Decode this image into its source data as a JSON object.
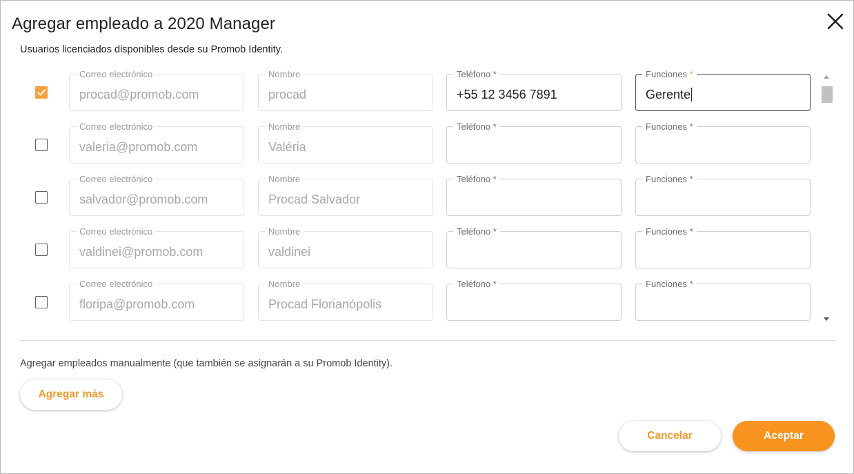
{
  "dialog": {
    "title": "Agregar empleado a 2020 Manager",
    "subtitle": "Usuarios licenciados disponibles desde su Promob Identity.",
    "manual_text": "Agregar empleados manualmente (que también se asignarán a su Promob Identity).",
    "add_more_label": "Agregar más",
    "cancel_label": "Cancelar",
    "accept_label": "Aceptar"
  },
  "labels": {
    "email": "Correo electrónico",
    "name": "Nombre",
    "phone": "Teléfono",
    "role": "Funciones",
    "required_mark": "*"
  },
  "users": [
    {
      "checked": true,
      "email": "procad@promob.com",
      "name": "procad",
      "phone": "+55 12 3456 7891",
      "role": "Gerente"
    },
    {
      "checked": false,
      "email": "valeria@promob.com",
      "name": "Valéria",
      "phone": "",
      "role": ""
    },
    {
      "checked": false,
      "email": "salvador@promob.com",
      "name": "Procad  Salvador",
      "phone": "",
      "role": ""
    },
    {
      "checked": false,
      "email": "valdinei@promob.com",
      "name": "valdinei",
      "phone": "",
      "role": ""
    },
    {
      "checked": false,
      "email": "floripa@promob.com",
      "name": "Procad  Florianópolis",
      "phone": "",
      "role": ""
    }
  ],
  "colors": {
    "accent": "#f7931e",
    "checkbox_checked": "#f6a13c"
  },
  "icons": {
    "close": "close-icon",
    "check": "check-icon"
  }
}
